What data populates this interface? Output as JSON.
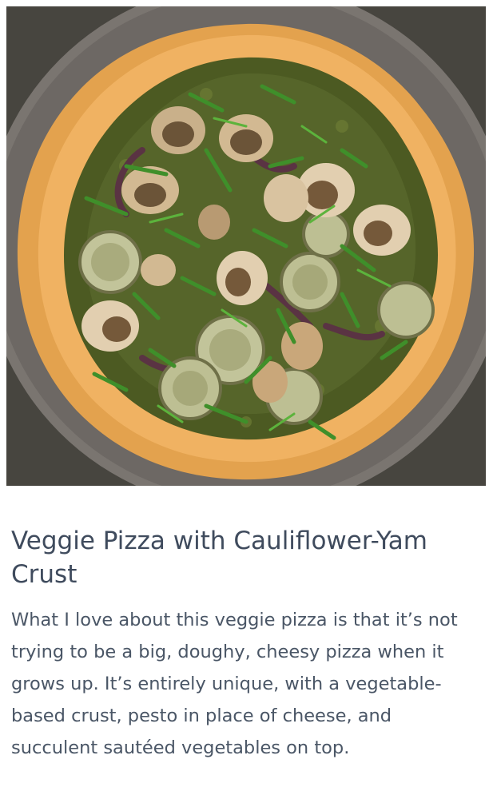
{
  "recipe": {
    "title": "Veggie Pizza with Cauliflower-Yam Crust",
    "description": "What I love about this veggie pizza is that it’s not trying to be a big, doughy, cheesy pizza when it grows up. It’s entirely unique, with a vegetable-based crust, pesto in place of cheese, and succulent sautéed vegetables on top."
  },
  "colors": {
    "background": "#ffffff",
    "title_text": "#3f4b5d",
    "body_text": "#4a5666",
    "stone": "#6e6a66",
    "crust": "#e3a24e",
    "pesto": "#4c5a22",
    "mushroom": "#c9b08a",
    "herb": "#3f8f2a"
  }
}
